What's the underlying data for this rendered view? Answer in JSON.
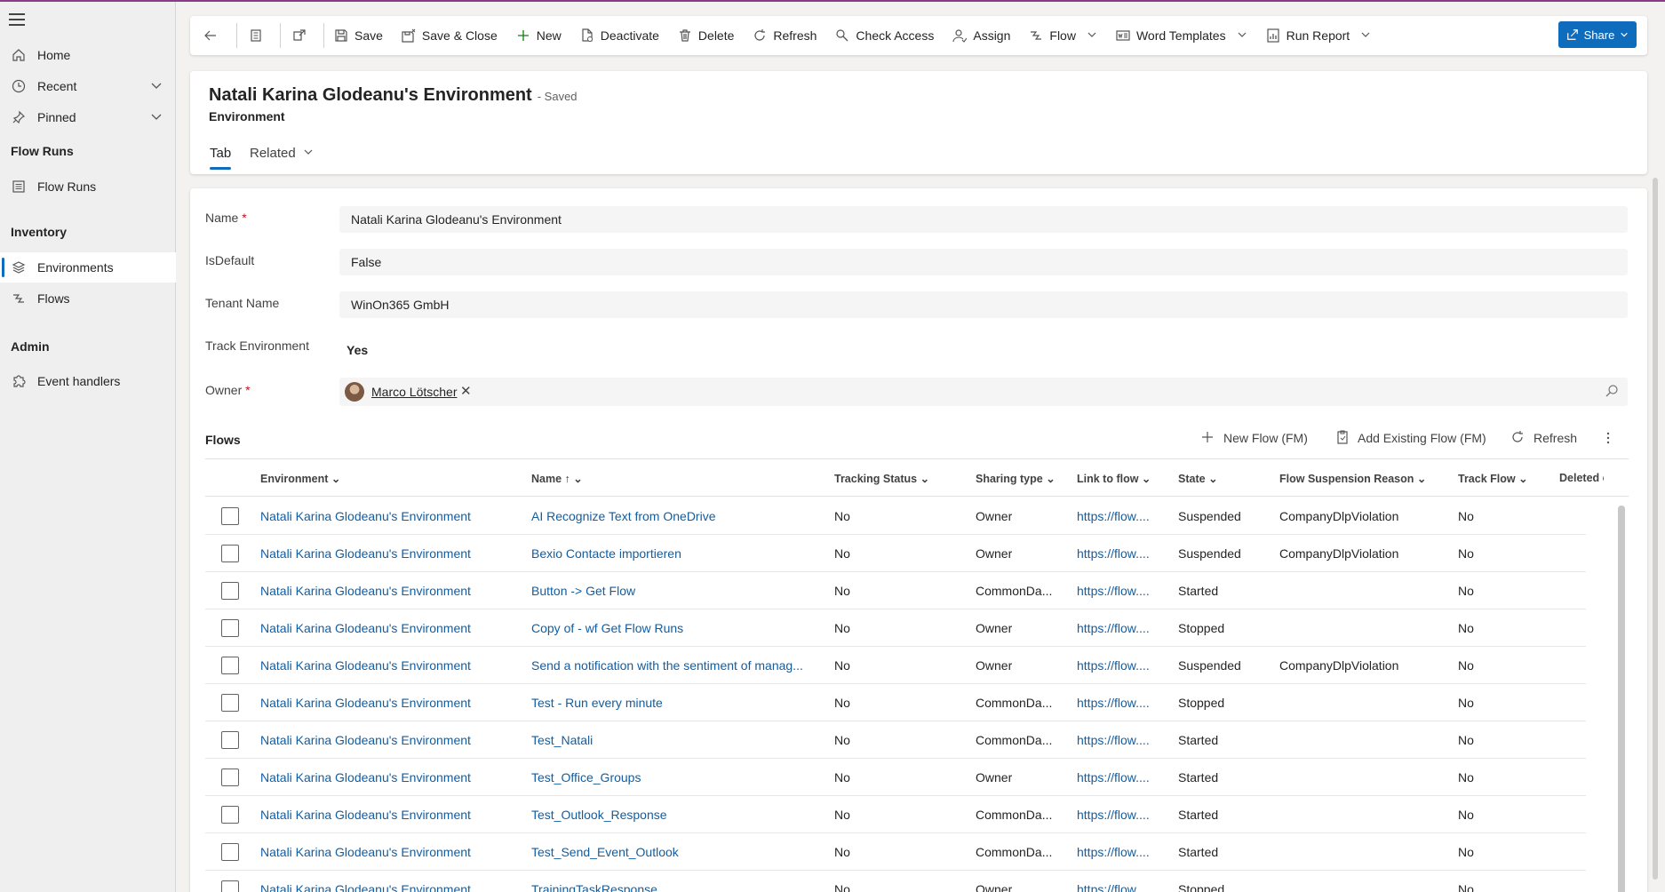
{
  "sidebar": {
    "items": [
      {
        "label": "Home",
        "icon": "home-icon"
      },
      {
        "label": "Recent",
        "icon": "clock-icon",
        "expandable": true
      },
      {
        "label": "Pinned",
        "icon": "pin-icon",
        "expandable": true
      }
    ],
    "groups": [
      {
        "heading": "Flow Runs",
        "items": [
          {
            "label": "Flow Runs",
            "icon": "list-icon"
          }
        ]
      },
      {
        "heading": "Inventory",
        "items": [
          {
            "label": "Environments",
            "icon": "layers-icon",
            "active": true
          },
          {
            "label": "Flows",
            "icon": "flow-icon"
          }
        ]
      },
      {
        "heading": "Admin",
        "items": [
          {
            "label": "Event handlers",
            "icon": "puzzle-icon"
          }
        ]
      }
    ]
  },
  "toolbar": {
    "save": "Save",
    "save_close": "Save & Close",
    "new": "New",
    "deactivate": "Deactivate",
    "delete": "Delete",
    "refresh": "Refresh",
    "check_access": "Check Access",
    "assign": "Assign",
    "flow": "Flow",
    "word_templates": "Word Templates",
    "run_report": "Run Report",
    "share": "Share"
  },
  "header": {
    "title": "Natali Karina Glodeanu's Environment",
    "status": "- Saved",
    "entity": "Environment",
    "tabs": [
      "Tab",
      "Related"
    ]
  },
  "form": {
    "name_label": "Name",
    "name_value": "Natali Karina Glodeanu's Environment",
    "isdefault_label": "IsDefault",
    "isdefault_value": "False",
    "tenant_label": "Tenant Name",
    "tenant_value": "WinOn365 GmbH",
    "track_label": "Track Environment",
    "track_value": "Yes",
    "owner_label": "Owner",
    "owner_value": "Marco Lötscher",
    "required_mark": "*"
  },
  "subgrid": {
    "title": "Flows",
    "commands": {
      "new_flow": "New Flow (FM)",
      "add_existing": "Add Existing Flow (FM)",
      "refresh": "Refresh"
    },
    "columns": [
      "Environment",
      "Name",
      "Tracking Status",
      "Sharing type",
      "Link to flow",
      "State",
      "Flow Suspension Reason",
      "Track Flow",
      "Deleted c"
    ],
    "rows": [
      {
        "env": "Natali Karina Glodeanu's Environment",
        "name": "AI Recognize Text from OneDrive",
        "tracking": "No",
        "sharing": "Owner",
        "link": "https://flow....",
        "state": "Suspended",
        "reason": "CompanyDlpViolation",
        "track": "No"
      },
      {
        "env": "Natali Karina Glodeanu's Environment",
        "name": "Bexio Contacte importieren",
        "tracking": "No",
        "sharing": "Owner",
        "link": "https://flow....",
        "state": "Suspended",
        "reason": "CompanyDlpViolation",
        "track": "No"
      },
      {
        "env": "Natali Karina Glodeanu's Environment",
        "name": "Button -> Get Flow",
        "tracking": "No",
        "sharing": "CommonDa...",
        "link": "https://flow....",
        "state": "Started",
        "reason": "",
        "track": "No"
      },
      {
        "env": "Natali Karina Glodeanu's Environment",
        "name": "Copy of - wf Get Flow Runs",
        "tracking": "No",
        "sharing": "Owner",
        "link": "https://flow....",
        "state": "Stopped",
        "reason": "",
        "track": "No"
      },
      {
        "env": "Natali Karina Glodeanu's Environment",
        "name": "Send a notification with the sentiment of manag...",
        "tracking": "No",
        "sharing": "Owner",
        "link": "https://flow....",
        "state": "Suspended",
        "reason": "CompanyDlpViolation",
        "track": "No"
      },
      {
        "env": "Natali Karina Glodeanu's Environment",
        "name": "Test - Run every minute",
        "tracking": "No",
        "sharing": "CommonDa...",
        "link": "https://flow....",
        "state": "Stopped",
        "reason": "",
        "track": "No"
      },
      {
        "env": "Natali Karina Glodeanu's Environment",
        "name": "Test_Natali",
        "tracking": "No",
        "sharing": "CommonDa...",
        "link": "https://flow....",
        "state": "Started",
        "reason": "",
        "track": "No"
      },
      {
        "env": "Natali Karina Glodeanu's Environment",
        "name": "Test_Office_Groups",
        "tracking": "No",
        "sharing": "Owner",
        "link": "https://flow....",
        "state": "Started",
        "reason": "",
        "track": "No"
      },
      {
        "env": "Natali Karina Glodeanu's Environment",
        "name": "Test_Outlook_Response",
        "tracking": "No",
        "sharing": "CommonDa...",
        "link": "https://flow....",
        "state": "Started",
        "reason": "",
        "track": "No"
      },
      {
        "env": "Natali Karina Glodeanu's Environment",
        "name": "Test_Send_Event_Outlook",
        "tracking": "No",
        "sharing": "CommonDa...",
        "link": "https://flow....",
        "state": "Started",
        "reason": "",
        "track": "No"
      },
      {
        "env": "Natali Karina Glodeanu's Environment",
        "name": "TrainingTaskResponse",
        "tracking": "No",
        "sharing": "Owner",
        "link": "https://flow....",
        "state": "Stopped",
        "reason": "",
        "track": "No"
      }
    ]
  },
  "colors": {
    "accent": "#0f6cbd",
    "link": "#115ea3",
    "topline": "#8a3b86"
  }
}
